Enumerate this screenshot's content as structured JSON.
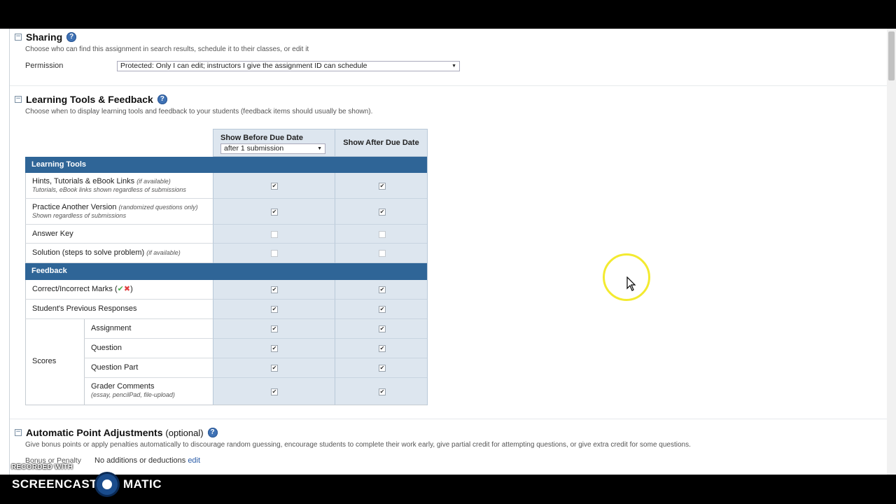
{
  "sharing": {
    "title": "Sharing",
    "description": "Choose who can find this assignment in search results, schedule it to their classes, or edit it",
    "permission_label": "Permission",
    "permission_value": "Protected: Only I can edit; instructors I give the assignment ID can schedule"
  },
  "learning": {
    "title": "Learning Tools & Feedback",
    "description": "Choose when to display learning tools and feedback to your students (feedback items should usually be shown).",
    "col_before": "Show Before Due Date",
    "col_before_select": "after 1 submission",
    "col_after": "Show After Due Date",
    "band_tools": "Learning Tools",
    "band_feedback": "Feedback",
    "rows": [
      {
        "label": "Hints, Tutorials & eBook Links",
        "note": "(if available)",
        "sub": "Tutorials, eBook links shown regardless of submissions",
        "before": true,
        "after": true
      },
      {
        "label": "Practice Another Version",
        "note": "(randomized questions only)",
        "sub": "Shown regardless of submissions",
        "before": true,
        "after": true
      },
      {
        "label": "Answer Key",
        "note": "",
        "sub": "",
        "before": false,
        "after": false
      },
      {
        "label": "Solution (steps to solve problem)",
        "note": "(if available)",
        "sub": "",
        "before": false,
        "after": false
      },
      {
        "label": "Correct/Incorrect Marks (",
        "note": ")",
        "sub": "",
        "before": true,
        "after": true
      },
      {
        "label": "Student's Previous Responses",
        "note": "",
        "sub": "",
        "before": true,
        "after": true
      },
      {
        "label": "Assignment",
        "note": "",
        "sub": "",
        "before": true,
        "after": true
      },
      {
        "label": "Question",
        "note": "",
        "sub": "",
        "before": true,
        "after": true
      },
      {
        "label": "Question Part",
        "note": "",
        "sub": "",
        "before": true,
        "after": true
      },
      {
        "label": "Grader Comments",
        "note": "",
        "sub": "(essay, pencilPad, file-upload)",
        "before": true,
        "after": true
      }
    ],
    "scores_label": "Scores"
  },
  "adjust": {
    "title": "Automatic Point Adjustments",
    "optional": "(optional)",
    "description": "Give bonus points or apply penalties automatically to discourage random guessing, encourage students to complete their work early, give partial credit for attempting questions, or give extra credit for some questions.",
    "bonus_label": "Bonus or Penalty",
    "bonus_value": "No additions or deductions",
    "edit_link": "edit"
  },
  "watermark": {
    "recorded": "RECORDED WITH",
    "brand_left": "SCREENCAST",
    "brand_right": "MATIC"
  },
  "icons": {
    "help": "help-icon",
    "check_mark": "✔",
    "correct": "✔",
    "incorrect": "✖"
  },
  "colors": {
    "band": "#2f6597",
    "header_cell": "#dde6ef",
    "help": "#3f72b5",
    "link": "#2a5ca8",
    "correct": "#4caf50",
    "incorrect": "#e04040",
    "cursor_ring": "#f3ea30"
  }
}
